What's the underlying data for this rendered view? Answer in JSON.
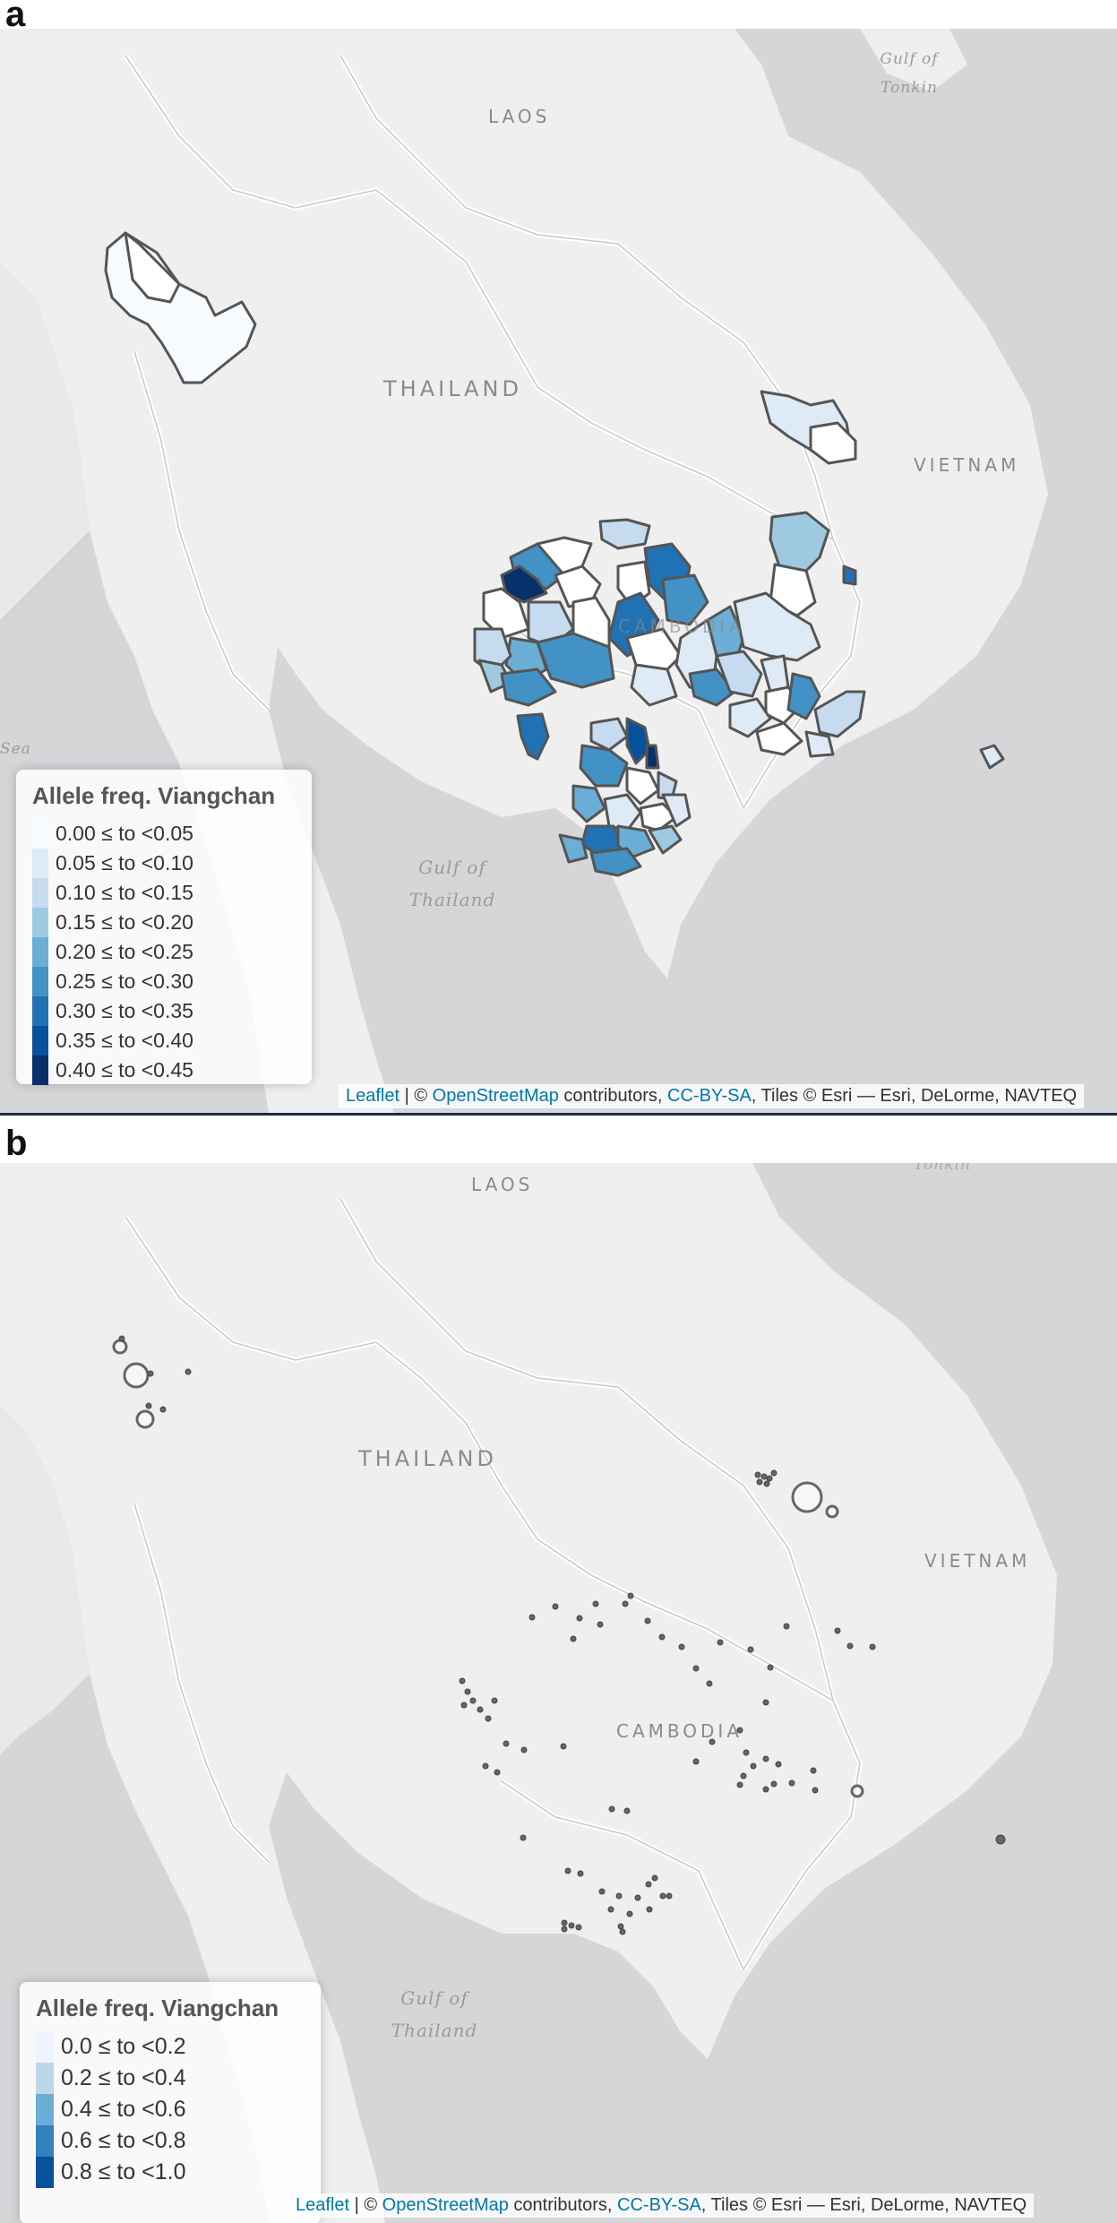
{
  "panel_a": {
    "letter": "a",
    "labels": {
      "laos": "LAOS",
      "thailand": "THAILAND",
      "vietnam": "VIETNAM",
      "cambodia": "CAMBODIA",
      "gulf_tonkin_1": "Gulf of",
      "gulf_tonkin_2": "Tonkin",
      "gulf_thailand_1": "Gulf of",
      "gulf_thailand_2": "Thailand",
      "sea": "Sea"
    },
    "legend": {
      "title": "Allele freq. Viangchan",
      "items": [
        {
          "label": "0.00 ≤ to <0.05",
          "color": "#f7fbff"
        },
        {
          "label": "0.05 ≤ to <0.10",
          "color": "#deebf7"
        },
        {
          "label": "0.10 ≤ to <0.15",
          "color": "#c6dbef"
        },
        {
          "label": "0.15 ≤ to <0.20",
          "color": "#9ecae1"
        },
        {
          "label": "0.20 ≤ to <0.25",
          "color": "#6baed6"
        },
        {
          "label": "0.25 ≤ to <0.30",
          "color": "#4292c6"
        },
        {
          "label": "0.30 ≤ to <0.35",
          "color": "#2171b5"
        },
        {
          "label": "0.35 ≤ to <0.40",
          "color": "#08519c"
        },
        {
          "label": "0.40 ≤ to <0.45",
          "color": "#08306b"
        }
      ]
    },
    "attribution": {
      "leaflet": "Leaflet",
      "sep1": " | © ",
      "osm": "OpenStreetMap",
      "mid": " contributors, ",
      "cc": "CC-BY-SA",
      "tail": ", Tiles © Esri — Esri, DeLorme, NAVTEQ"
    }
  },
  "panel_b": {
    "letter": "b",
    "labels": {
      "laos": "LAOS",
      "thailand": "THAILAND",
      "vietnam": "VIETNAM",
      "cambodia": "CAMBODIA",
      "gulf_thailand_1": "Gulf of",
      "gulf_thailand_2": "Thailand",
      "tonkin_partial": "Tonkin"
    },
    "legend": {
      "title": "Allele freq. Viangchan",
      "items": [
        {
          "label": "0.0 ≤ to <0.2",
          "color": "#eff3ff"
        },
        {
          "label": "0.2 ≤ to <0.4",
          "color": "#bdd7e7"
        },
        {
          "label": "0.4 ≤ to <0.6",
          "color": "#6baed6"
        },
        {
          "label": "0.6 ≤ to <0.8",
          "color": "#3182bd"
        },
        {
          "label": "0.8 ≤ to <1.0",
          "color": "#08519c"
        }
      ]
    },
    "attribution": {
      "leaflet": "Leaflet",
      "sep1": " | © ",
      "osm": "OpenStreetMap",
      "mid": " contributors, ",
      "cc": "CC-BY-SA",
      "tail": ", Tiles © Esri — Esri, DeLorme, NAVTEQ"
    }
  }
}
